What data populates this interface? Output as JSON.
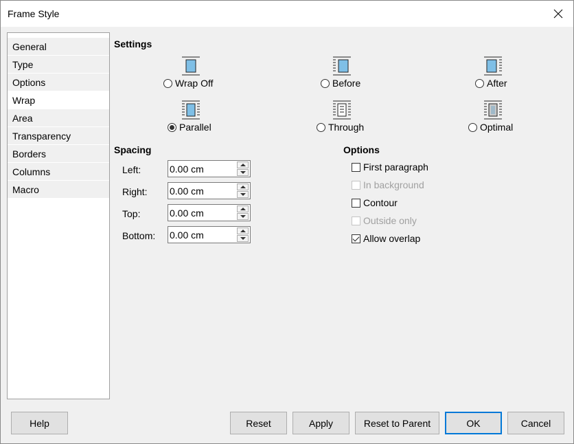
{
  "window": {
    "title": "Frame Style"
  },
  "sidebar": {
    "items": [
      {
        "label": "General"
      },
      {
        "label": "Type"
      },
      {
        "label": "Options"
      },
      {
        "label": "Wrap"
      },
      {
        "label": "Area"
      },
      {
        "label": "Transparency"
      },
      {
        "label": "Borders"
      },
      {
        "label": "Columns"
      },
      {
        "label": "Macro"
      }
    ],
    "active": "Wrap"
  },
  "settings": {
    "heading": "Settings",
    "options": [
      {
        "label": "Wrap Off",
        "icon": "wrap-off-icon",
        "checked": false
      },
      {
        "label": "Before",
        "icon": "wrap-before-icon",
        "checked": false
      },
      {
        "label": "After",
        "icon": "wrap-after-icon",
        "checked": false
      },
      {
        "label": "Parallel",
        "icon": "wrap-parallel-icon",
        "checked": true
      },
      {
        "label": "Through",
        "icon": "wrap-through-icon",
        "checked": false
      },
      {
        "label": "Optimal",
        "icon": "wrap-optimal-icon",
        "checked": false
      }
    ]
  },
  "spacing": {
    "heading": "Spacing",
    "fields": [
      {
        "label": "Left:",
        "value": "0.00 cm"
      },
      {
        "label": "Right:",
        "value": "0.00 cm"
      },
      {
        "label": "Top:",
        "value": "0.00 cm"
      },
      {
        "label": "Bottom:",
        "value": "0.00 cm"
      }
    ]
  },
  "options": {
    "heading": "Options",
    "items": [
      {
        "label": "First paragraph",
        "checked": false,
        "enabled": true
      },
      {
        "label": "In background",
        "checked": false,
        "enabled": false
      },
      {
        "label": "Contour",
        "checked": false,
        "enabled": true
      },
      {
        "label": "Outside only",
        "checked": false,
        "enabled": false
      },
      {
        "label": "Allow overlap",
        "checked": true,
        "enabled": true
      }
    ]
  },
  "buttons": {
    "help": "Help",
    "reset": "Reset",
    "apply": "Apply",
    "reset_to_parent": "Reset to Parent",
    "ok": "OK",
    "cancel": "Cancel"
  },
  "colors": {
    "accent": "#0078d7",
    "frame_fill": "#7fbfe6",
    "optimal_fill": "#9fb9c9"
  }
}
